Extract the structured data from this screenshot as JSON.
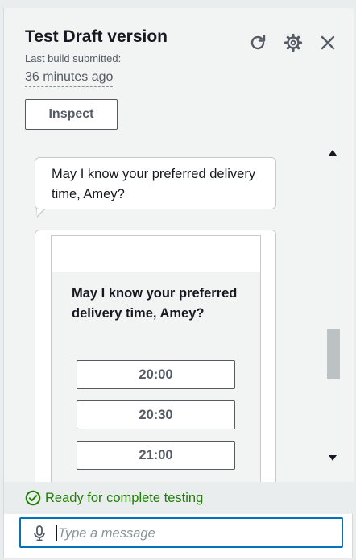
{
  "header": {
    "title": "Test Draft version",
    "subtitle": "Last build submitted:",
    "time_ago": "36 minutes ago",
    "inspect_label": "Inspect",
    "icons": [
      "refresh-icon",
      "settings-icon",
      "close-icon"
    ]
  },
  "chat": {
    "bot_message": "May I know your preferred delivery time, Amey?",
    "card": {
      "question": "May I know your preferred delivery time, Amey?",
      "options": [
        "20:00",
        "20:30",
        "21:00"
      ]
    }
  },
  "status": {
    "text": "Ready for complete testing",
    "color": "#1d8102"
  },
  "input": {
    "placeholder": "Type a message",
    "value": ""
  },
  "colors": {
    "accent": "#0073bb",
    "success": "#1d8102",
    "text": "#16191f",
    "muted": "#545b64"
  }
}
